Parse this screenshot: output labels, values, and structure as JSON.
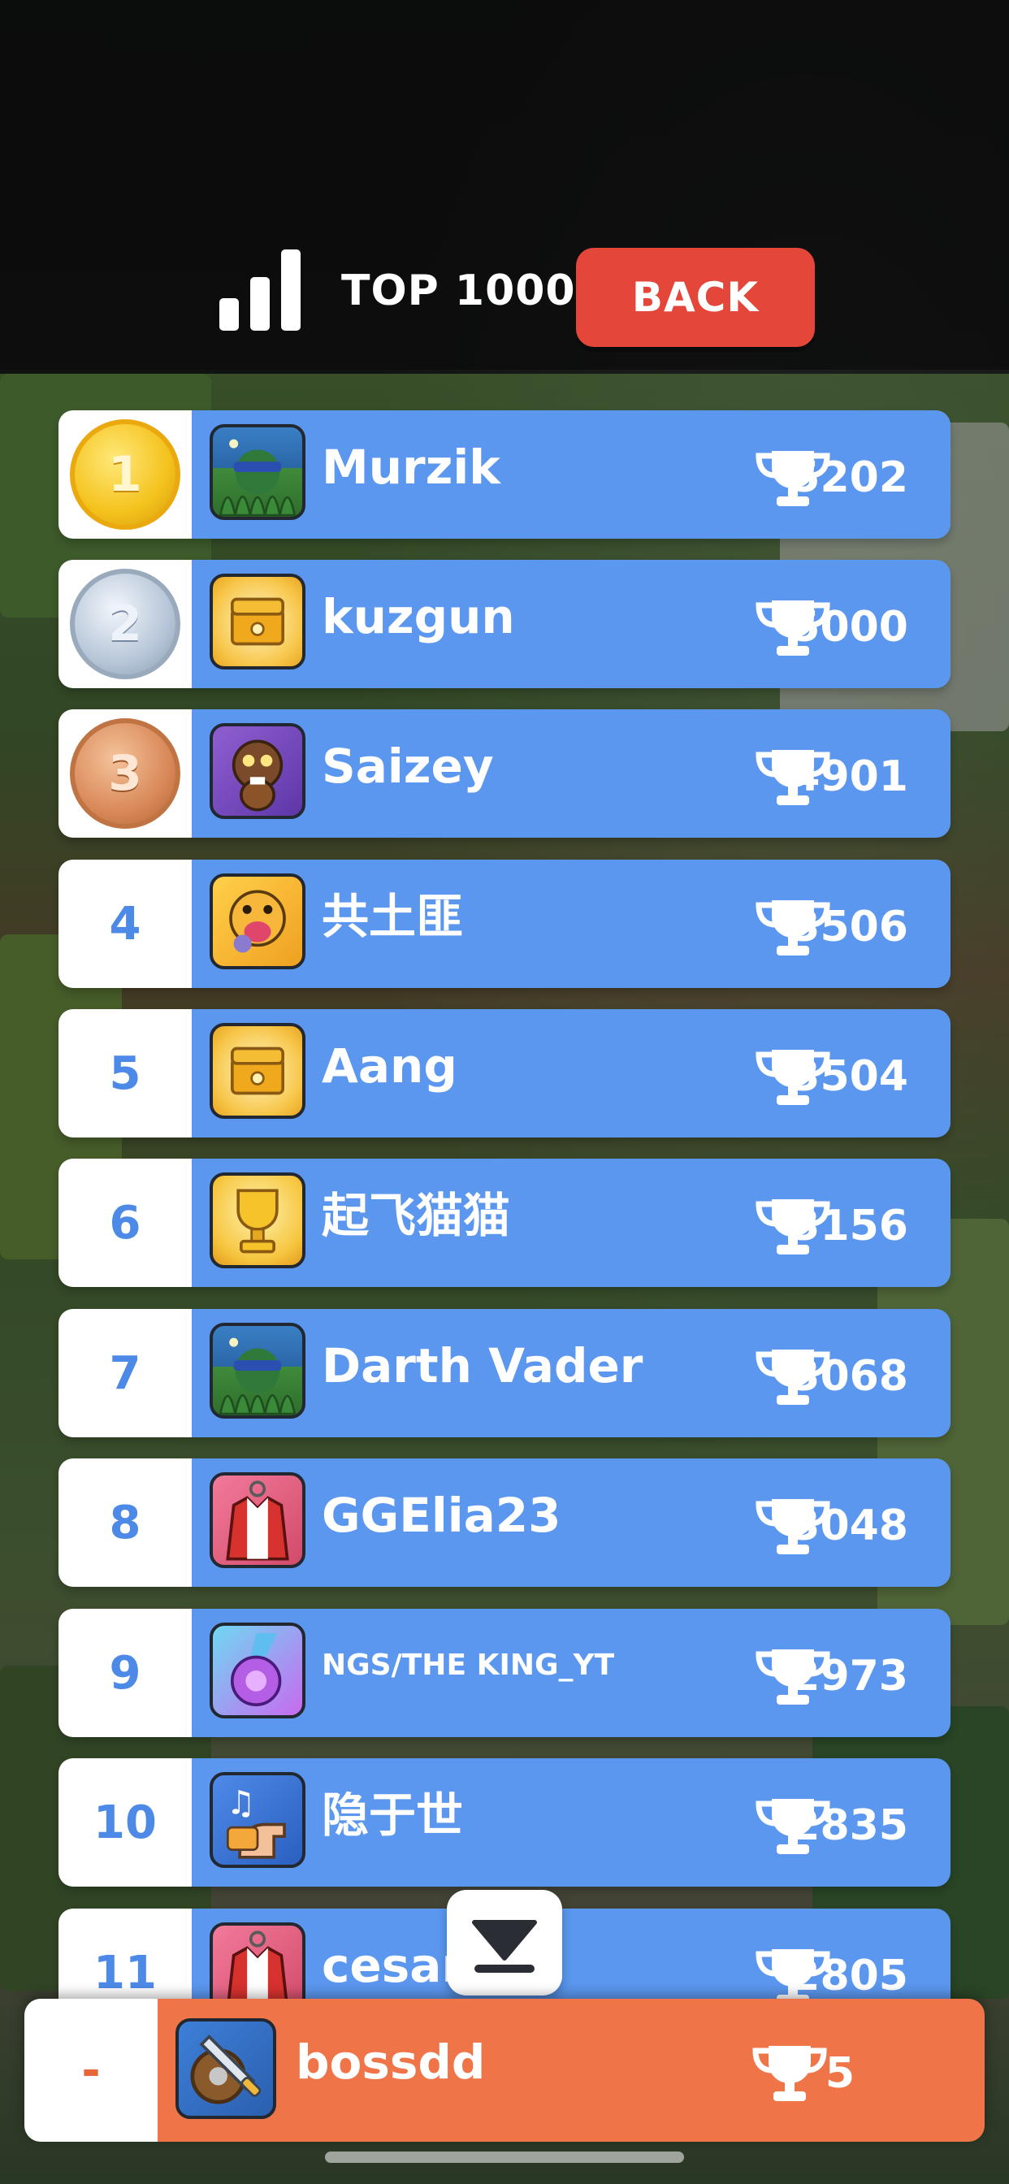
{
  "header": {
    "top_label": "TOP 1000",
    "back_label": "BACK",
    "rank_icon": "bar-chart-icon"
  },
  "leaderboard": [
    {
      "rank": "1",
      "medal": "gold",
      "name": "Murzik",
      "score": "5202",
      "avatar": "bush-headband-avatar"
    },
    {
      "rank": "2",
      "medal": "silver",
      "name": "kuzgun",
      "score": "5000",
      "avatar": "treasure-chest-avatar"
    },
    {
      "rank": "3",
      "medal": "bronze",
      "name": "Saizey",
      "score": "4901",
      "avatar": "beaver-acorn-avatar"
    },
    {
      "rank": "4",
      "name": "共土匪",
      "score": "3506",
      "avatar": "yellow-dog-avatar"
    },
    {
      "rank": "5",
      "name": "Aang",
      "score": "3504",
      "avatar": "treasure-chest-avatar"
    },
    {
      "rank": "6",
      "name": "起飞猫猫",
      "score": "3156",
      "avatar": "gold-trophy-avatar"
    },
    {
      "rank": "7",
      "name": "Darth Vader",
      "score": "3068",
      "avatar": "bush-headband-avatar"
    },
    {
      "rank": "8",
      "name": "GGElia23",
      "score": "3048",
      "avatar": "red-jacket-avatar"
    },
    {
      "rank": "9",
      "name": "NGS/THE KING_YT",
      "score": "2973",
      "avatar": "purple-medal-avatar"
    },
    {
      "rank": "10",
      "name": "隐于世",
      "score": "2835",
      "avatar": "music-hand-avatar"
    },
    {
      "rank": "11",
      "name": "cesar",
      "score": "2805",
      "avatar": "red-jacket-avatar"
    }
  ],
  "self": {
    "rank": "-",
    "name": "bossdd",
    "score": "5",
    "avatar": "sword-shield-avatar"
  },
  "scroll_button": {
    "icon": "scroll-to-bottom-icon"
  },
  "colors": {
    "row_blue": "#5b97ef",
    "self_orange": "#ef7549",
    "back_red": "#e4463a",
    "rank_text": "#4d8ae8"
  }
}
